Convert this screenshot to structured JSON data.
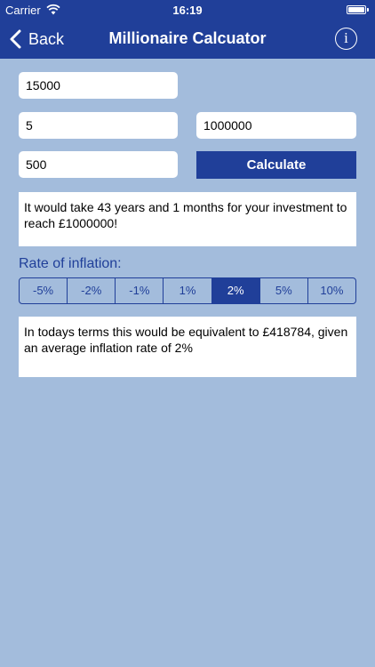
{
  "status_bar": {
    "carrier": "Carrier",
    "time": "16:19"
  },
  "nav": {
    "back_label": "Back",
    "title": "Millionaire Calcuator",
    "info_glyph": "i"
  },
  "inputs": {
    "amount": "15000",
    "rate": "5",
    "target": "1000000",
    "monthly": "500"
  },
  "calculate_label": "Calculate",
  "result_text": "It would take 43 years and 1 months for your investment to reach £1000000!",
  "inflation": {
    "label": "Rate of inflation:",
    "options": [
      "-5%",
      "-2%",
      "-1%",
      "1%",
      "2%",
      "5%",
      "10%"
    ],
    "selected": "2%"
  },
  "inflation_result_text": "In todays terms this would be equivalent to £418784, given an average inflation rate of 2%",
  "colors": {
    "bar": "#203f99",
    "background": "#a3bcdc"
  },
  "icons": [
    "wifi-icon",
    "battery-icon",
    "chevron-left-icon",
    "info-icon"
  ]
}
